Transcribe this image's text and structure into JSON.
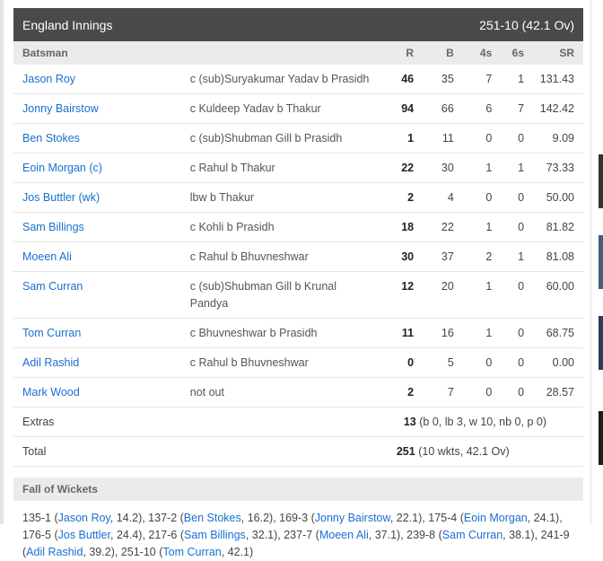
{
  "innings": {
    "title": "England Innings",
    "score": "251-10 (42.1 Ov)"
  },
  "columns": {
    "batsman": "Batsman",
    "runs": "R",
    "balls": "B",
    "fours": "4s",
    "sixes": "6s",
    "strike_rate": "SR"
  },
  "batsmen": [
    {
      "name": "Jason Roy",
      "dismissal": "c (sub)Suryakumar Yadav b Prasidh",
      "r": "46",
      "b": "35",
      "fours": "7",
      "sixes": "1",
      "sr": "131.43"
    },
    {
      "name": "Jonny Bairstow",
      "dismissal": "c Kuldeep Yadav b Thakur",
      "r": "94",
      "b": "66",
      "fours": "6",
      "sixes": "7",
      "sr": "142.42"
    },
    {
      "name": "Ben Stokes",
      "dismissal": "c (sub)Shubman Gill b Prasidh",
      "r": "1",
      "b": "11",
      "fours": "0",
      "sixes": "0",
      "sr": "9.09"
    },
    {
      "name": "Eoin Morgan (c)",
      "dismissal": "c Rahul b Thakur",
      "r": "22",
      "b": "30",
      "fours": "1",
      "sixes": "1",
      "sr": "73.33"
    },
    {
      "name": "Jos Buttler (wk)",
      "dismissal": "lbw b Thakur",
      "r": "2",
      "b": "4",
      "fours": "0",
      "sixes": "0",
      "sr": "50.00"
    },
    {
      "name": "Sam Billings",
      "dismissal": "c Kohli b Prasidh",
      "r": "18",
      "b": "22",
      "fours": "1",
      "sixes": "0",
      "sr": "81.82"
    },
    {
      "name": "Moeen Ali",
      "dismissal": "c Rahul b Bhuvneshwar",
      "r": "30",
      "b": "37",
      "fours": "2",
      "sixes": "1",
      "sr": "81.08"
    },
    {
      "name": "Sam Curran",
      "dismissal": "c (sub)Shubman Gill b Krunal Pandya",
      "r": "12",
      "b": "20",
      "fours": "1",
      "sixes": "0",
      "sr": "60.00"
    },
    {
      "name": "Tom Curran",
      "dismissal": "c Bhuvneshwar b Prasidh",
      "r": "11",
      "b": "16",
      "fours": "1",
      "sixes": "0",
      "sr": "68.75"
    },
    {
      "name": "Adil Rashid",
      "dismissal": "c Rahul b Bhuvneshwar",
      "r": "0",
      "b": "5",
      "fours": "0",
      "sixes": "0",
      "sr": "0.00"
    },
    {
      "name": "Mark Wood",
      "dismissal": "not out",
      "r": "2",
      "b": "7",
      "fours": "0",
      "sixes": "0",
      "sr": "28.57"
    }
  ],
  "extras": {
    "label": "Extras",
    "total": "13",
    "detail": "(b 0, lb 3, w 10, nb 0, p 0)"
  },
  "total": {
    "label": "Total",
    "runs": "251",
    "detail": "(10 wkts, 42.1 Ov)"
  },
  "fall_of_wickets": {
    "title": "Fall of Wickets",
    "items": [
      {
        "score": "135-1",
        "player": "Jason Roy",
        "over": "14.2"
      },
      {
        "score": "137-2",
        "player": "Ben Stokes",
        "over": "16.2"
      },
      {
        "score": "169-3",
        "player": "Jonny Bairstow",
        "over": "22.1"
      },
      {
        "score": "175-4",
        "player": "Eoin Morgan",
        "over": "24.1"
      },
      {
        "score": "176-5",
        "player": "Jos Buttler",
        "over": "24.4"
      },
      {
        "score": "217-6",
        "player": "Sam Billings",
        "over": "32.1"
      },
      {
        "score": "237-7",
        "player": "Moeen Ali",
        "over": "37.1"
      },
      {
        "score": "239-8",
        "player": "Sam Curran",
        "over": "38.1"
      },
      {
        "score": "241-9",
        "player": "Adil Rashid",
        "over": "39.2"
      },
      {
        "score": "251-10",
        "player": "Tom Curran",
        "over": "42.1"
      }
    ]
  },
  "colors": {
    "header_bg": "#4a4a4a",
    "subheader_bg": "#ebebeb",
    "link": "#1a6fd0"
  }
}
